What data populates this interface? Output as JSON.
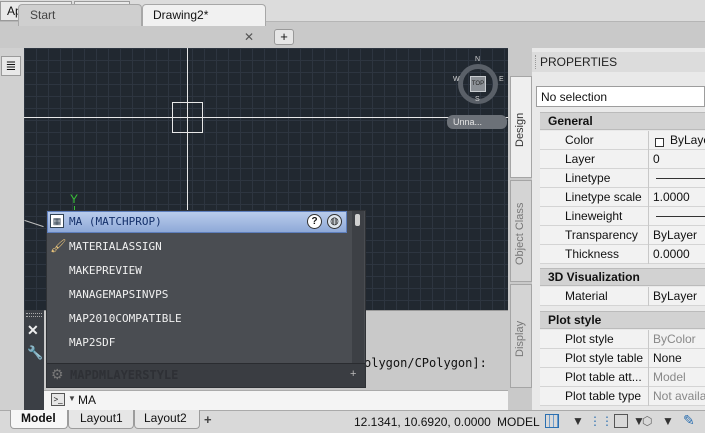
{
  "topbar": {
    "app_store": "App Store",
    "dropdown_glyph": "▼"
  },
  "tabs": [
    {
      "label": "Start"
    },
    {
      "label": "Drawing2*"
    }
  ],
  "tab_close_glyph": "✕",
  "tab_new_glyph": "+",
  "viewcube": {
    "north": "N",
    "south": "S",
    "east": "E",
    "west": "W",
    "top_face": "TOP",
    "wcs_label": "Unna..."
  },
  "ucs": {
    "y_label": "Y"
  },
  "autocomplete": {
    "items": [
      "MA (MATCHPROP)",
      "MATERIALASSIGN",
      "MAKEPREVIEW",
      "MANAGEMAPSINVPS",
      "MAP2010COMPATIBLE",
      "MAP2SDF"
    ],
    "footer": "MAPDMLAYERSTYLE",
    "help_glyph": "?",
    "footer_plus": "+"
  },
  "command": {
    "history_text": "olygon/CPolygon]:",
    "input_value": "MA"
  },
  "vertical_tabs": [
    "Design",
    "Object Class",
    "Display"
  ],
  "properties": {
    "title": "PROPERTIES",
    "selection": "No selection",
    "sections": {
      "general": "General",
      "visualization": "3D Visualization",
      "plot": "Plot style"
    },
    "general_rows": [
      {
        "label": "Color",
        "value": "ByLayer"
      },
      {
        "label": "Layer",
        "value": "0"
      },
      {
        "label": "Linetype",
        "value": ""
      },
      {
        "label": "Linetype scale",
        "value": "1.0000"
      },
      {
        "label": "Lineweight",
        "value": ""
      },
      {
        "label": "Transparency",
        "value": "ByLayer"
      },
      {
        "label": "Thickness",
        "value": "0.0000"
      }
    ],
    "visualization_rows": [
      {
        "label": "Material",
        "value": "ByLayer"
      }
    ],
    "plot_rows": [
      {
        "label": "Plot style",
        "value": "ByColor"
      },
      {
        "label": "Plot style table",
        "value": "None"
      },
      {
        "label": "Plot table att...",
        "value": "Model"
      },
      {
        "label": "Plot table type",
        "value": "Not availa"
      }
    ]
  },
  "statusbar": {
    "layout_tabs": [
      "Model",
      "Layout1",
      "Layout2"
    ],
    "add_layout": "+",
    "coordinates": "12.1341, 10.6920, 0.0000",
    "space": "MODEL"
  },
  "colors": {
    "canvas_bg": "#212830",
    "selection_blue": "#8fa9d8",
    "ucs_green": "#38c038"
  }
}
